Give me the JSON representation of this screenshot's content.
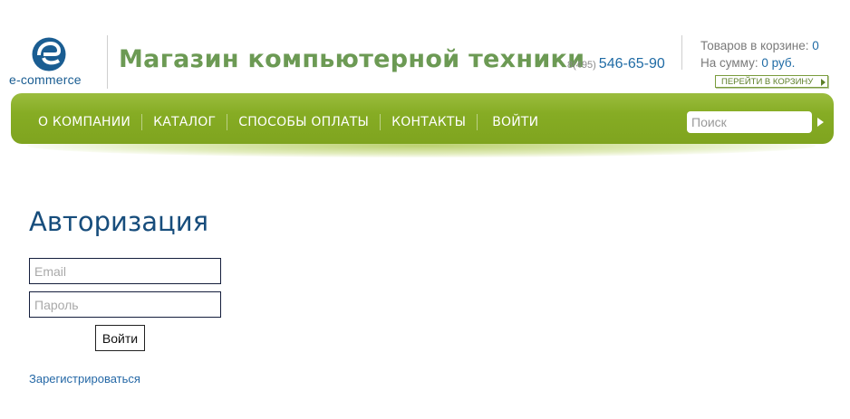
{
  "header": {
    "logo_text": "e-commerce",
    "site_title": "Магазин компьютерной техники",
    "phone_code": "8(495)",
    "phone_number": "546-65-90",
    "cart_items_label": "Товаров в корзине:",
    "cart_items_count": "0",
    "cart_sum_label": "На сумму:",
    "cart_sum_value": "0 руб.",
    "cart_button_label": "ПЕРЕЙТИ В КОРЗИНУ"
  },
  "nav": {
    "items": [
      "О КОМПАНИИ",
      "КАТАЛОГ",
      "СПОСОБЫ ОПЛАТЫ",
      "КОНТАКТЫ",
      "ВОЙТИ"
    ],
    "search_placeholder": "Поиск"
  },
  "auth": {
    "title": "Авторизация",
    "email_placeholder": "Email",
    "password_placeholder": "Пароль",
    "submit_label": "Войти",
    "register_link": "Зарегистрироваться"
  },
  "colors": {
    "brand_blue": "#1a5d92",
    "title_green": "#6c9a54",
    "nav_green": "#86ac24",
    "link_blue": "#2568a6"
  },
  "icons": {
    "logo": "e-logo-icon",
    "cart_arrow": "arrow-right-icon",
    "search_go": "arrow-right-icon"
  }
}
